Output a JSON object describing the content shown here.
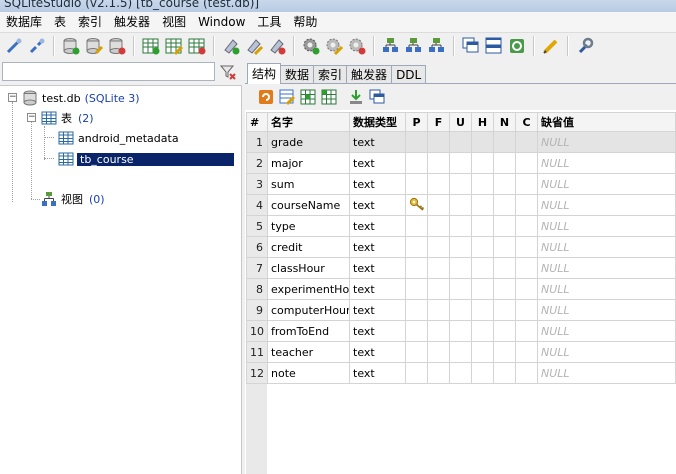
{
  "window": {
    "title": "SQLiteStudio (v2.1.5) [tb_course (test.db)]"
  },
  "menu": [
    "数据库",
    "表",
    "索引",
    "触发器",
    "视图",
    "Window",
    "工具",
    "帮助"
  ],
  "toolbar_icons": [
    "connect-icon",
    "disconnect-icon",
    "add-database-icon",
    "edit-database-icon",
    "remove-database-icon",
    "new-table-icon",
    "edit-table-icon",
    "drop-table-icon",
    "new-index-icon",
    "edit-index-icon",
    "drop-index-icon",
    "new-trigger-icon",
    "edit-trigger-icon",
    "drop-trigger-icon",
    "new-view-icon",
    "edit-view-icon",
    "drop-view-icon",
    "tile-windows-icon",
    "tile-horizontal-icon",
    "refresh-icon",
    "pencil-icon",
    "settings-wrench-icon"
  ],
  "filter": {
    "value": "",
    "placeholder": ""
  },
  "tree": {
    "database": "test.db",
    "database_type": "(SQLite 3)",
    "tables_label": "表",
    "tables_count": "(2)",
    "tables": [
      "android_metadata",
      "tb_course"
    ],
    "views_label": "视图",
    "views_count": "(0)"
  },
  "tabs": [
    "结构",
    "数据",
    "索引",
    "触发器",
    "DDL"
  ],
  "active_tab": "结构",
  "columns_header": {
    "num": "#",
    "name": "名字",
    "type": "数据类型",
    "p": "P",
    "f": "F",
    "u": "U",
    "h": "H",
    "n": "N",
    "c": "C",
    "default": "缺省值"
  },
  "columns": [
    {
      "n": "1",
      "name": "grade",
      "type": "text",
      "pk": false,
      "default": "NULL"
    },
    {
      "n": "2",
      "name": "major",
      "type": "text",
      "pk": false,
      "default": "NULL"
    },
    {
      "n": "3",
      "name": "sum",
      "type": "text",
      "pk": false,
      "default": "NULL"
    },
    {
      "n": "4",
      "name": "courseName",
      "type": "text",
      "pk": true,
      "default": "NULL"
    },
    {
      "n": "5",
      "name": "type",
      "type": "text",
      "pk": false,
      "default": "NULL"
    },
    {
      "n": "6",
      "name": "credit",
      "type": "text",
      "pk": false,
      "default": "NULL"
    },
    {
      "n": "7",
      "name": "classHour",
      "type": "text",
      "pk": false,
      "default": "NULL"
    },
    {
      "n": "8",
      "name": "experimentHour",
      "type": "text",
      "pk": false,
      "default": "NULL"
    },
    {
      "n": "9",
      "name": "computerHour",
      "type": "text",
      "pk": false,
      "default": "NULL"
    },
    {
      "n": "10",
      "name": "fromToEnd",
      "type": "text",
      "pk": false,
      "default": "NULL"
    },
    {
      "n": "11",
      "name": "teacher",
      "type": "text",
      "pk": false,
      "default": "NULL"
    },
    {
      "n": "12",
      "name": "note",
      "type": "text",
      "pk": false,
      "default": "NULL"
    }
  ]
}
